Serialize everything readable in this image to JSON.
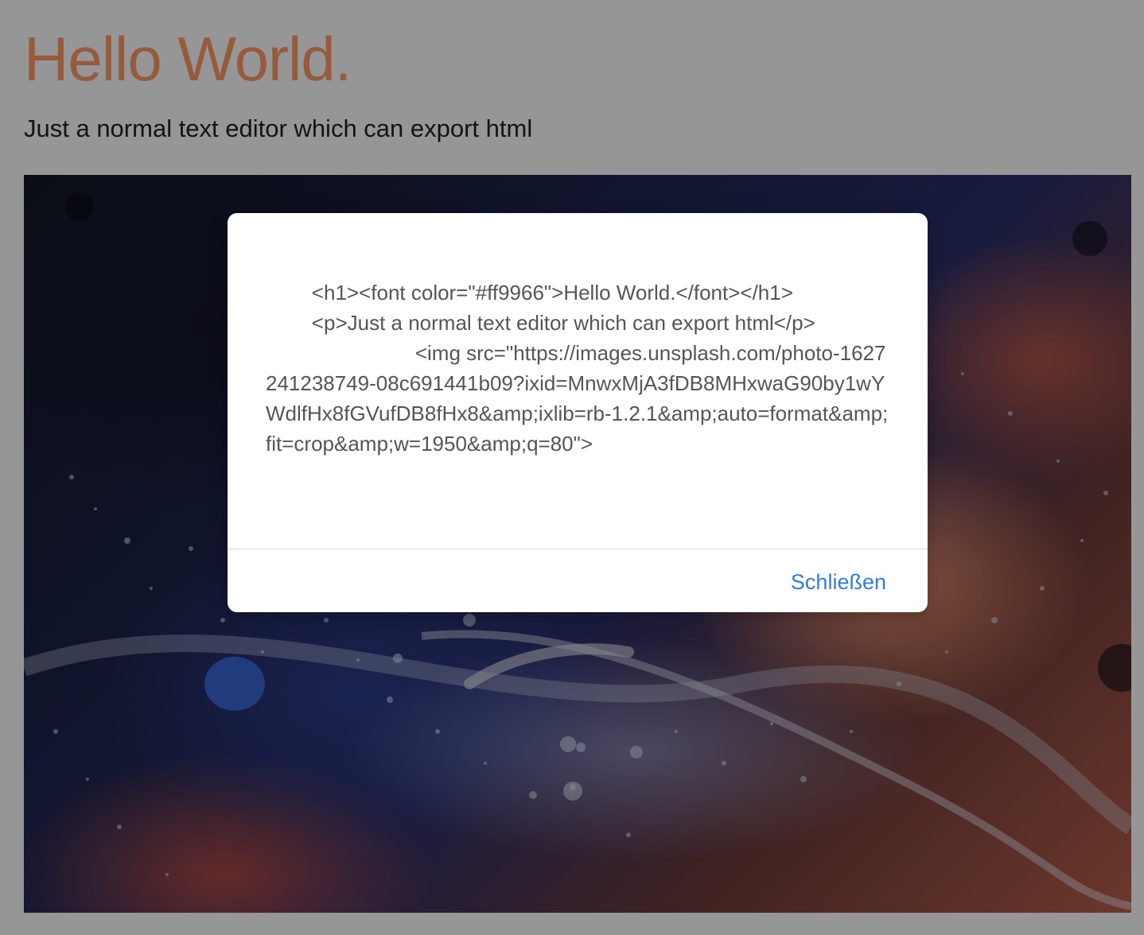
{
  "editor": {
    "heading": "Hello World.",
    "heading_color": "#ff9966",
    "paragraph": "Just a normal text editor which can export html",
    "image_label": "photo"
  },
  "dialog": {
    "code_text": "        <h1><font color=\"#ff9966\">Hello World.</font></h1>\n        <p>Just a normal text editor which can export html</p>\n                          <img src=\"https://images.unsplash.com/photo-1627241238749-08c691441b09?ixid=MnwxMjA3fDB8MHxwaG90by1wYWdlfHx8fGVufDB8fHx8&amp;ixlib=rb-1.2.1&amp;auto=format&amp;fit=crop&amp;w=1950&amp;q=80\">",
    "close_label": "Schließen",
    "accent_color": "#2f7de1"
  }
}
